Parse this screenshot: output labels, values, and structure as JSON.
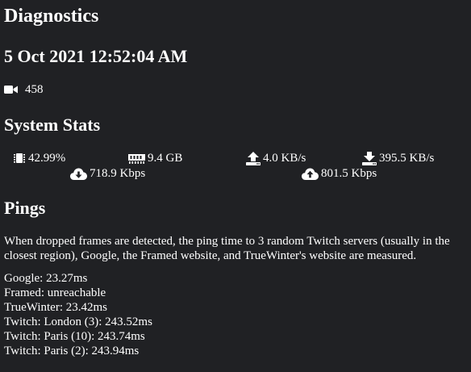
{
  "header": {
    "title": "Diagnostics",
    "datetime": "5 Oct 2021 12:52:04 AM"
  },
  "viewers": {
    "icon": "video-camera-icon",
    "count": "458"
  },
  "system_stats": {
    "title": "System Stats",
    "cpu": {
      "icon": "cpu-chip-icon",
      "value": "42.99%"
    },
    "memory": {
      "icon": "memory-icon",
      "value": "9.4 GB"
    },
    "upload_rate": {
      "icon": "upload-icon",
      "value": "4.0 KB/s"
    },
    "download_rate": {
      "icon": "download-icon",
      "value": "395.5 KB/s"
    },
    "cloud_download": {
      "icon": "cloud-download-icon",
      "value": "718.9 Kbps"
    },
    "cloud_upload": {
      "icon": "cloud-upload-icon",
      "value": "801.5 Kbps"
    }
  },
  "pings": {
    "title": "Pings",
    "description": "When dropped frames are detected, the ping time to 3 random Twitch servers (usually in the closest region), Google, the Framed website, and TrueWinter's website are measured.",
    "results": [
      "Google: 23.27ms",
      "Framed: unreachable",
      "TrueWinter: 23.42ms",
      "Twitch: London (3): 243.52ms",
      "Twitch: Paris (10): 243.74ms",
      "Twitch: Paris (2): 243.94ms"
    ]
  },
  "colors": {
    "background": "#202124",
    "text": "#ffffff"
  }
}
